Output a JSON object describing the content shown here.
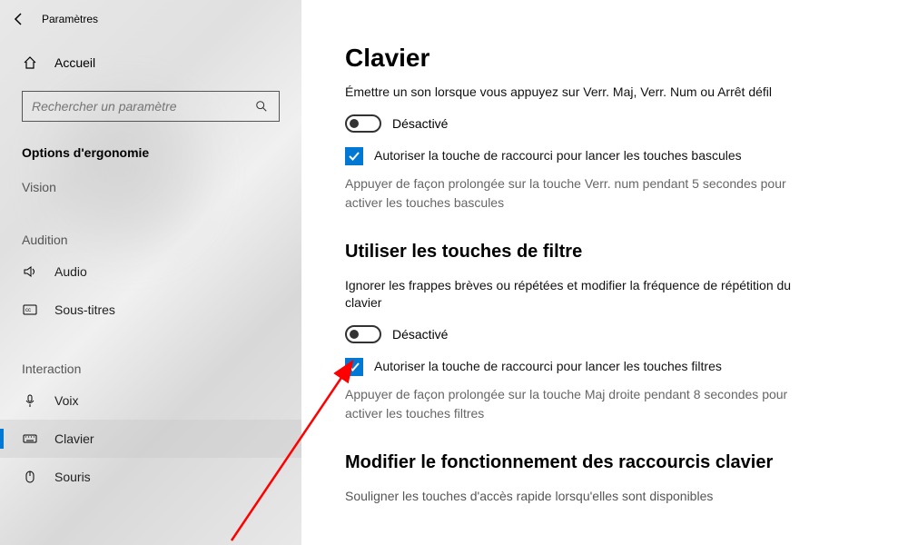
{
  "header": {
    "app_title": "Paramètres"
  },
  "sidebar": {
    "home_label": "Accueil",
    "search_placeholder": "Rechercher un paramètre",
    "section_title": "Options d'ergonomie",
    "groups": [
      {
        "label": "Vision",
        "items": []
      },
      {
        "label": "Audition",
        "items": [
          {
            "key": "audio",
            "label": "Audio",
            "icon": "volume"
          },
          {
            "key": "captions",
            "label": "Sous-titres",
            "icon": "cc"
          }
        ]
      },
      {
        "label": "Interaction",
        "items": [
          {
            "key": "voice",
            "label": "Voix",
            "icon": "mic"
          },
          {
            "key": "keyboard",
            "label": "Clavier",
            "icon": "keyboard",
            "selected": true
          },
          {
            "key": "mouse",
            "label": "Souris",
            "icon": "mouse"
          }
        ]
      }
    ]
  },
  "main": {
    "title": "Clavier",
    "toggle_keys": {
      "desc": "Émettre un son lorsque vous appuyez sur Verr. Maj, Verr. Num ou Arrêt défil",
      "toggle_state_label": "Désactivé",
      "shortcut_checkbox": "Autoriser la touche de raccourci pour lancer les touches bascules",
      "shortcut_hint": "Appuyer de façon prolongée sur la touche Verr. num pendant 5 secondes pour activer les touches bascules"
    },
    "filter_keys": {
      "heading": "Utiliser les touches de filtre",
      "desc": "Ignorer les frappes brèves ou répétées et modifier la fréquence de répétition du clavier",
      "toggle_state_label": "Désactivé",
      "shortcut_checkbox": "Autoriser la touche de raccourci pour lancer les touches filtres",
      "shortcut_hint": "Appuyer de façon prolongée sur la touche Maj droite pendant 8 secondes pour activer les touches filtres"
    },
    "shortcuts": {
      "heading": "Modifier le fonctionnement des raccourcis clavier",
      "desc": "Souligner les touches d'accès rapide lorsqu'elles sont disponibles"
    }
  }
}
